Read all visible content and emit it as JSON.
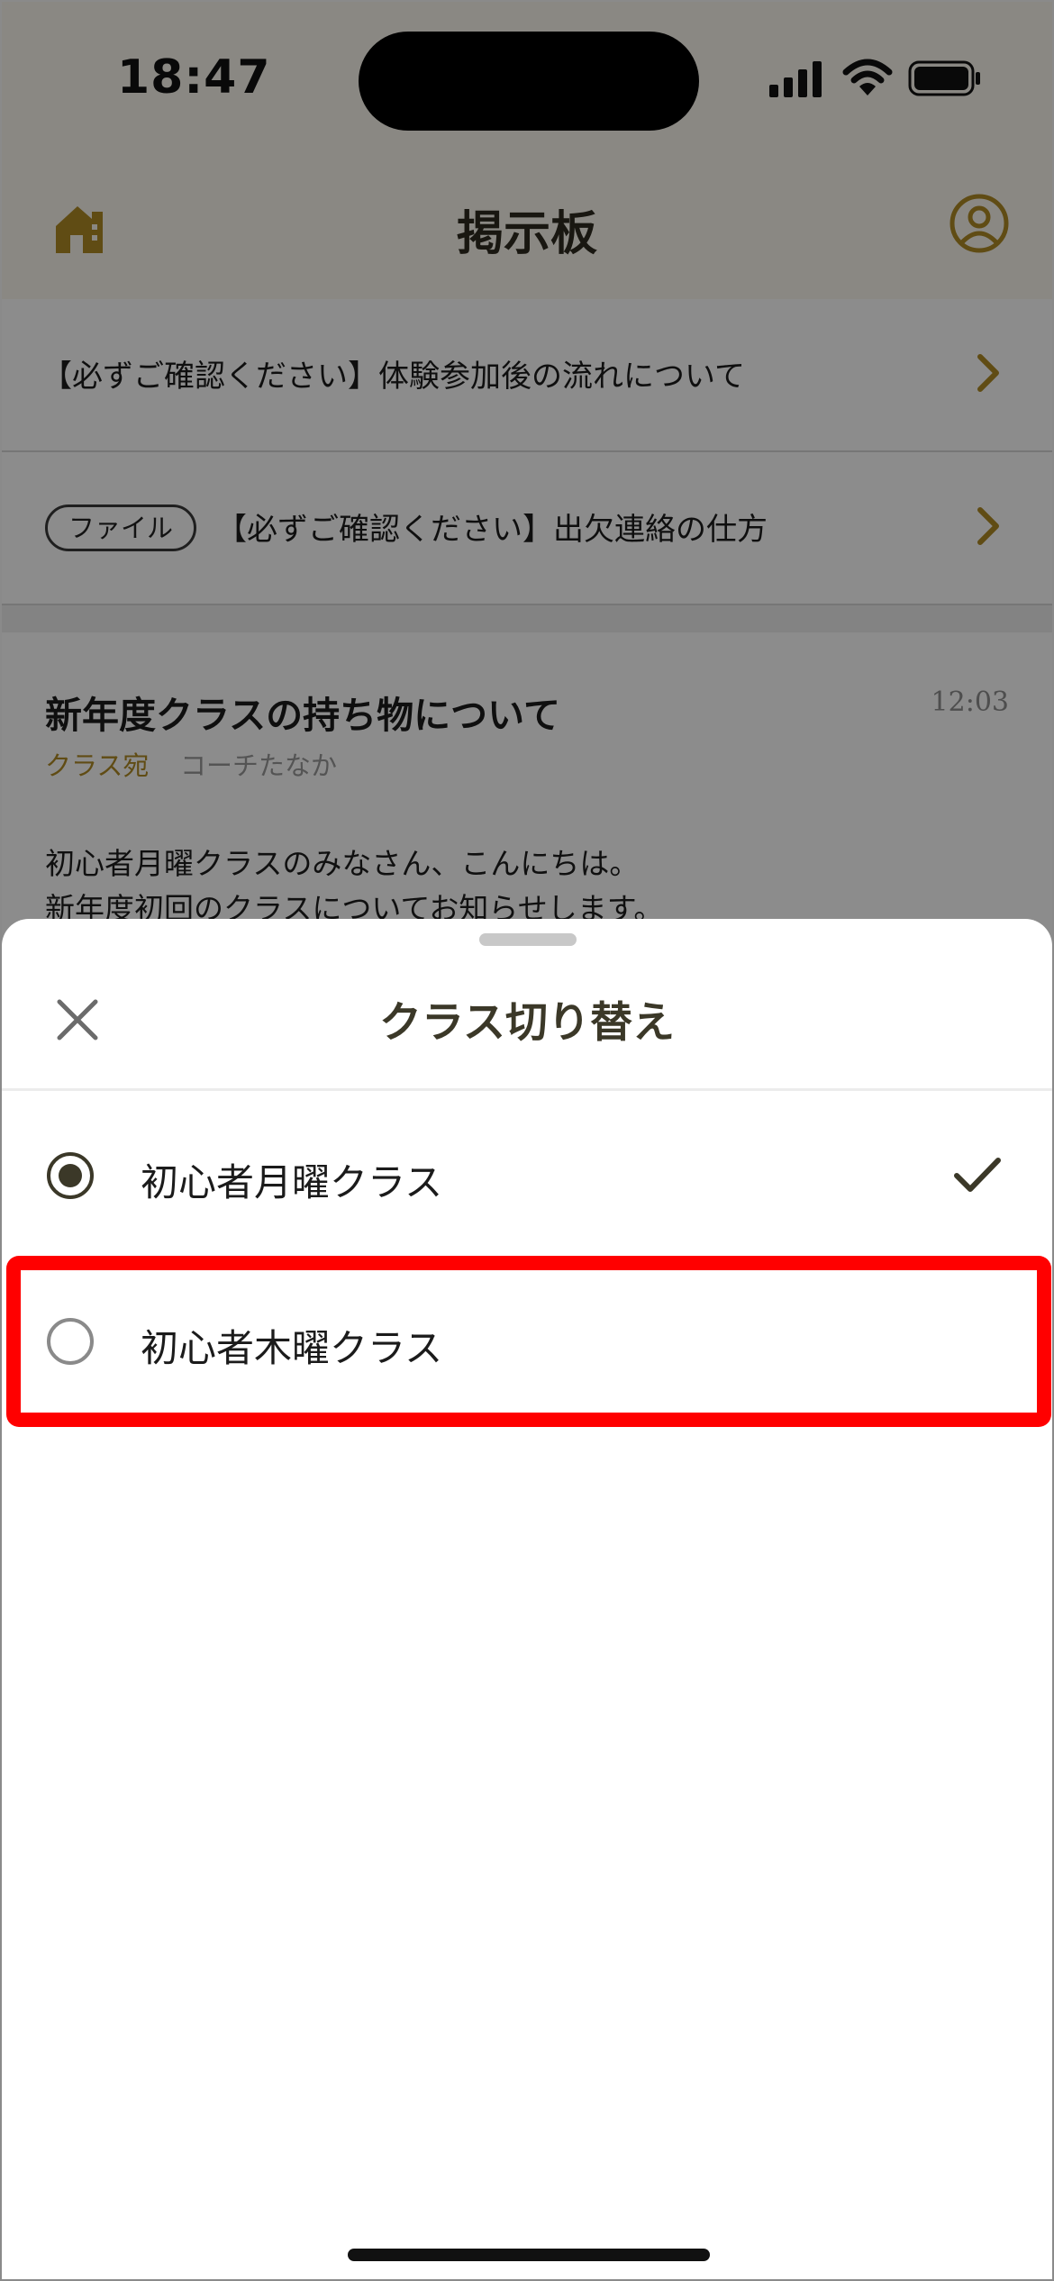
{
  "status_bar": {
    "time": "18:47"
  },
  "nav": {
    "title": "掲示板",
    "home_icon": "home-icon",
    "profile_icon": "user-circle-icon",
    "accent_color": "#b08a25"
  },
  "board": {
    "rows": [
      {
        "text": "【必ずご確認ください】体験参加後の流れについて"
      },
      {
        "badge": "ファイル",
        "text": "【必ずご確認ください】出欠連絡の仕方"
      }
    ],
    "post": {
      "title": "新年度クラスの持ち物について",
      "time": "12:03",
      "audience": "クラス宛",
      "author": "コーチたなか",
      "body_line_1": "初心者月曜クラスのみなさん、こんにちは。",
      "body_line_2": "新年度初回のクラスについてお知らせします。"
    }
  },
  "sheet": {
    "title": "クラス切り替え",
    "close_icon": "close-icon",
    "options": [
      {
        "label": "初心者月曜クラス",
        "selected": true
      },
      {
        "label": "初心者木曜クラス",
        "selected": false
      }
    ],
    "highlight_color": "#ff0000"
  }
}
